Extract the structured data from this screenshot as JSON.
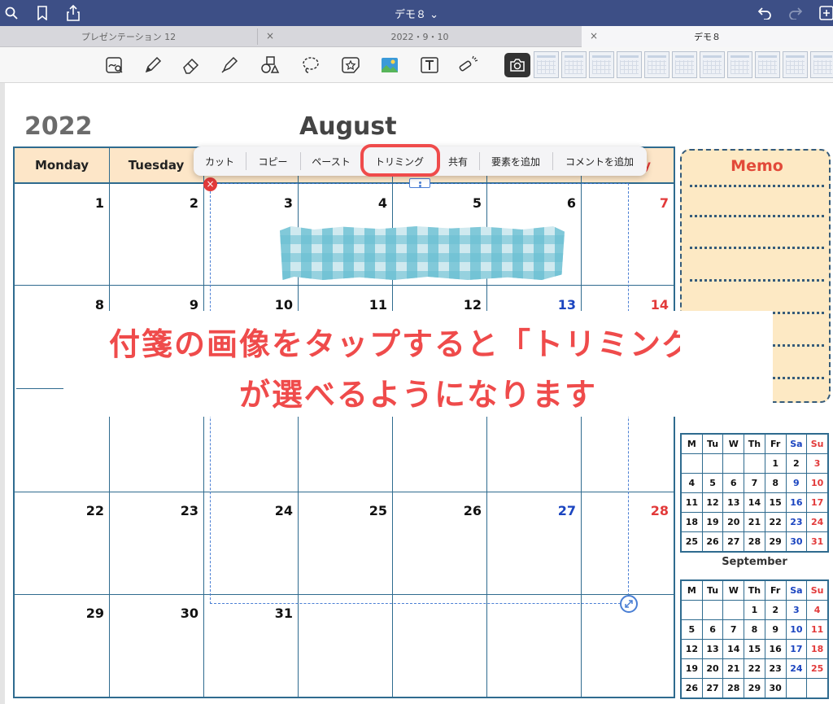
{
  "topbar": {
    "title": "デモ８ ⌄"
  },
  "tabs": [
    {
      "label": "プレゼンテーション 12"
    },
    {
      "label": "2022・9・10"
    },
    {
      "label": "デモ８"
    }
  ],
  "calendar": {
    "year": "2022",
    "month": "August",
    "headers": [
      "Monday",
      "Tuesday",
      "",
      "",
      "",
      "",
      "y"
    ],
    "weeks": [
      [
        "1",
        "2",
        "3",
        "4",
        "5",
        "6",
        "7"
      ],
      [
        "8",
        "9",
        "10",
        "11",
        "12",
        "13",
        "14"
      ],
      [
        "",
        "",
        "",
        "",
        "",
        "",
        ""
      ],
      [
        "22",
        "23",
        "24",
        "25",
        "26",
        "27",
        "28"
      ],
      [
        "29",
        "30",
        "31",
        "",
        "",
        "",
        ""
      ]
    ]
  },
  "context_menu": {
    "items": [
      "カット",
      "コピー",
      "ペースト",
      "トリミング",
      "共有",
      "要素を追加",
      "コメントを追加"
    ]
  },
  "overlay": {
    "line1": "付箋の画像をタップすると「トリミング」",
    "line2": "が選べるようになります"
  },
  "memo": {
    "title": "Memo"
  },
  "mini_calendars": [
    {
      "label": "",
      "headers": [
        "M",
        "Tu",
        "W",
        "Th",
        "Fr",
        "Sa",
        "Su"
      ],
      "rows": [
        [
          "",
          "",
          "",
          "",
          "",
          "2",
          "3"
        ],
        [
          "4",
          "5",
          "6",
          "7",
          "8",
          "9",
          "10"
        ],
        [
          "11",
          "12",
          "13",
          "14",
          "15",
          "16",
          "17"
        ],
        [
          "18",
          "19",
          "20",
          "21",
          "22",
          "23",
          "24"
        ],
        [
          "25",
          "26",
          "27",
          "28",
          "29",
          "30",
          "31"
        ]
      ]
    },
    {
      "label": "September",
      "headers": [
        "M",
        "Tu",
        "W",
        "Th",
        "Fr",
        "Sa",
        "Su"
      ],
      "rows": [
        [
          "",
          "",
          "",
          "1",
          "2",
          "3",
          "4"
        ],
        [
          "5",
          "6",
          "7",
          "8",
          "9",
          "10",
          "11"
        ],
        [
          "12",
          "13",
          "14",
          "15",
          "16",
          "17",
          "18"
        ],
        [
          "19",
          "20",
          "21",
          "22",
          "23",
          "24",
          "25"
        ],
        [
          "26",
          "27",
          "28",
          "29",
          "30",
          "",
          ""
        ]
      ]
    }
  ],
  "mini_first_row_partial": "1",
  "colors": {
    "accent": "#ef4b4b",
    "topbar": "#3d4f86",
    "grid": "#2f6b8f",
    "header_fill": "#fde6c8",
    "saturday": "#1b45c0",
    "sunday": "#e23a3a"
  },
  "icons": [
    "search-icon",
    "bookmark-icon",
    "share-icon",
    "undo-icon",
    "redo-icon",
    "add-page-icon",
    "lasso-read-icon",
    "pen-icon",
    "eraser-icon",
    "highlighter-icon",
    "shapes-icon",
    "lasso-icon",
    "sticker-icon",
    "image-icon",
    "textbox-icon",
    "laser-pointer-icon",
    "camera-icon"
  ]
}
